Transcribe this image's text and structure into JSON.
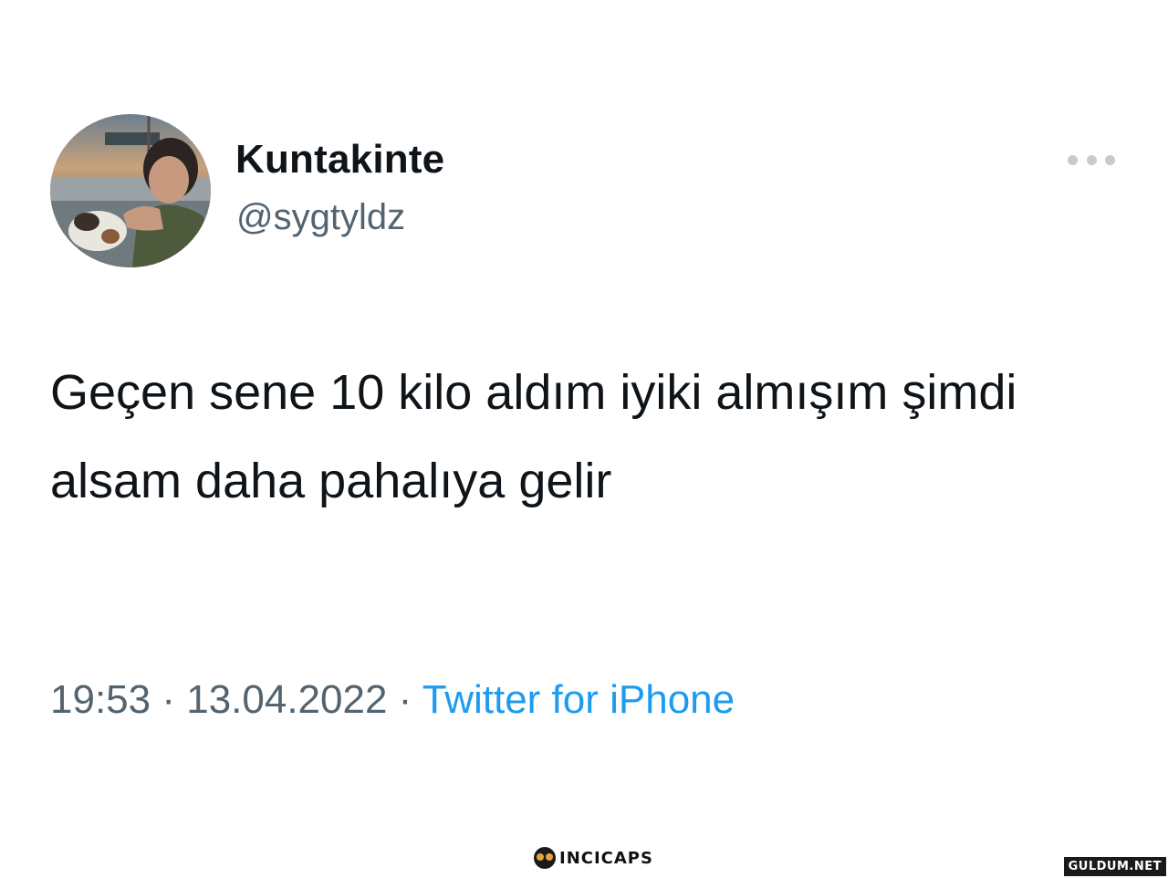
{
  "tweet": {
    "display_name": "Kuntakinte",
    "handle": "@sygtyldz",
    "text": "Geçen sene 10 kilo aldım iyiki almışım şimdi alsam daha pahalıya gelir",
    "time": "19:53",
    "separator": " · ",
    "date": "13.04.2022",
    "source": "Twitter for iPhone",
    "more_icon": "more-horizontal-icon"
  },
  "watermarks": {
    "brand": "INCICAPS",
    "brand_icon": "owl-icon",
    "site": "GULDUM.NET"
  },
  "colors": {
    "text_primary": "#0f1419",
    "text_secondary": "#536471",
    "link": "#1d9bf0"
  }
}
